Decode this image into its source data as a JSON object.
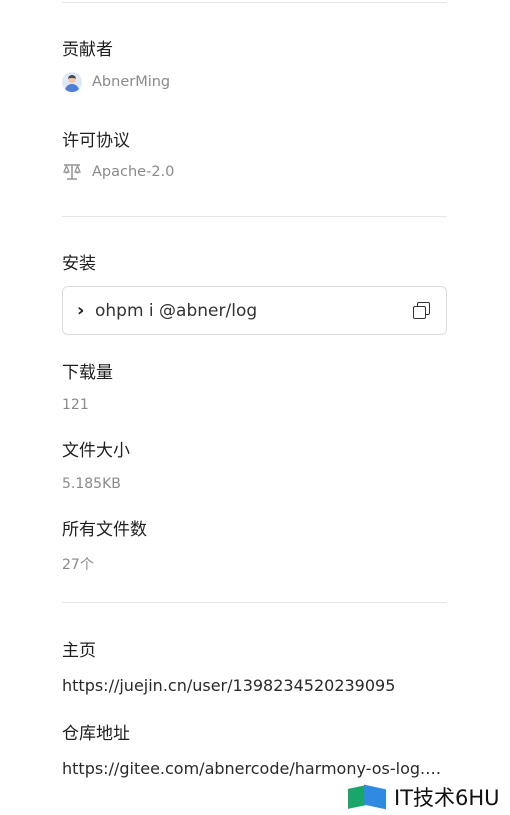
{
  "contributors": {
    "label": "贡献者",
    "name": "AbnerMing"
  },
  "license": {
    "label": "许可协议",
    "value": "Apache-2.0"
  },
  "install": {
    "label": "安装",
    "prompt": "›",
    "command": "ohpm i @abner/log"
  },
  "downloads": {
    "label": "下载量",
    "value": "121"
  },
  "file_size": {
    "label": "文件大小",
    "value": "5.185KB"
  },
  "file_count": {
    "label": "所有文件数",
    "value": "27个"
  },
  "homepage": {
    "label": "主页",
    "value": "https://juejin.cn/user/1398234520239095"
  },
  "repository": {
    "label": "仓库地址",
    "value": "https://gitee.com/abnercode/harmony-os-log.…"
  },
  "brand": {
    "text": "IT技术6HU"
  },
  "icons": {
    "avatar": "user-avatar-icon",
    "license": "scales-icon",
    "copy": "copy-icon",
    "chevron": "chevron-right-icon"
  }
}
